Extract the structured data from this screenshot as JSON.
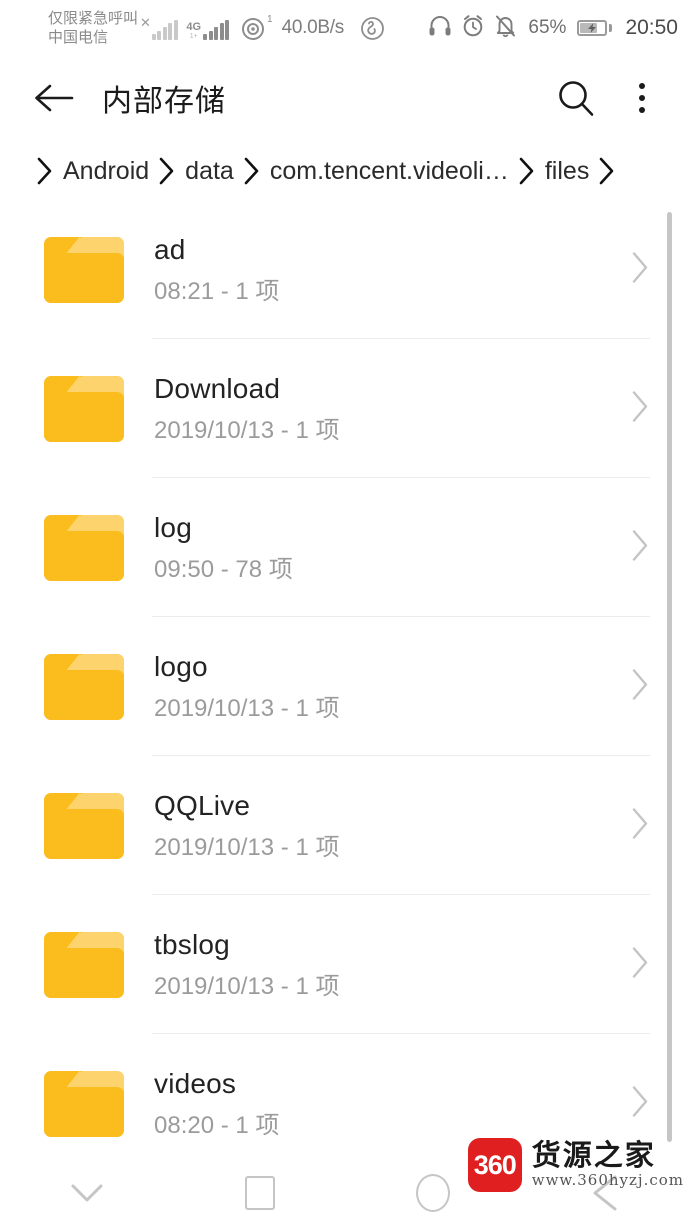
{
  "status_bar": {
    "carrier_line1": "仅限紧急呼叫",
    "carrier_line2": "中国电信",
    "sim1_state_icon": "no-service-x-icon",
    "sim2_network_label": "4G",
    "sim2_network_sub": "1+",
    "hotspot_icon": "hotspot-icon",
    "hotspot_superscript": "1",
    "network_speed": "40.0B/s",
    "music_icon": "netease-music-icon",
    "headphone_icon": "headphone-icon",
    "alarm_icon": "alarm-clock-icon",
    "mute_icon": "bell-muted-icon",
    "battery_percent": "65%",
    "battery_icon": "battery-charging-icon",
    "clock": "20:50"
  },
  "title_bar": {
    "back_icon": "back-arrow-icon",
    "title": "内部存储",
    "search_icon": "search-icon",
    "menu_icon": "more-vertical-icon"
  },
  "breadcrumb": {
    "separator": "chevron-right-icon",
    "items": [
      {
        "label": "Android"
      },
      {
        "label": "data"
      },
      {
        "label": "com.tencent.videoli…"
      },
      {
        "label": "files"
      }
    ]
  },
  "file_list": {
    "chevron_icon": "chevron-right-icon",
    "folder_icon": "folder-icon",
    "folder_color": "#fbbd1e",
    "folder_tab_color": "#fcd36c",
    "rows": [
      {
        "name": "ad",
        "meta": "08:21 - 1 项"
      },
      {
        "name": "Download",
        "meta": "2019/10/13 - 1 项"
      },
      {
        "name": "log",
        "meta": "09:50 - 78 项"
      },
      {
        "name": "logo",
        "meta": "2019/10/13 - 1 项"
      },
      {
        "name": "QQLive",
        "meta": "2019/10/13 - 1 项"
      },
      {
        "name": "tbslog",
        "meta": "2019/10/13 - 1 项"
      },
      {
        "name": "videos",
        "meta": "08:20 - 1 项"
      }
    ]
  },
  "nav_bar": {
    "hide_keyboard_icon": "chevron-down-icon",
    "recents_icon": "square-icon",
    "home_icon": "circle-icon",
    "back_icon": "triangle-back-icon"
  },
  "watermark": {
    "logo_text": "360",
    "logo_color": "#e02020",
    "name": "货源之家",
    "url": "www.360hyzj.com"
  }
}
